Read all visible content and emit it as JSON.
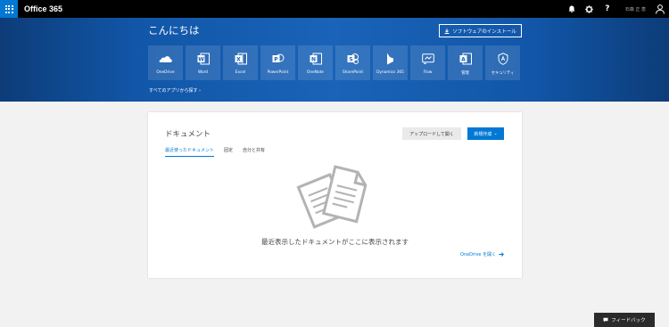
{
  "topbar": {
    "brand": "Office 365",
    "icons": [
      "waffle-icon",
      "bell-icon",
      "gear-icon",
      "help-icon",
      "user-avatar-icon"
    ],
    "help_glyph": "?",
    "user_name": "石森 正 恵"
  },
  "hero": {
    "greeting": "こんにちは",
    "install_label": "ソフトウェアのインストール",
    "all_apps_label": "すべてのアプリから探す",
    "tiles": [
      {
        "label": "OneDrive",
        "icon": "onedrive-icon"
      },
      {
        "label": "Word",
        "icon": "word-icon",
        "letter": "W"
      },
      {
        "label": "Excel",
        "icon": "excel-icon",
        "letter": "X"
      },
      {
        "label": "PowerPoint",
        "icon": "powerpoint-icon",
        "letter": "P"
      },
      {
        "label": "OneNote",
        "icon": "onenote-icon",
        "letter": "N"
      },
      {
        "label": "SharePoint",
        "icon": "sharepoint-icon",
        "letter": "S"
      },
      {
        "label": "Dynamics 365",
        "icon": "dynamics-icon"
      },
      {
        "label": "Flow",
        "icon": "flow-icon"
      },
      {
        "label": "管理",
        "icon": "admin-icon",
        "letter": "A"
      },
      {
        "label": "セキュリティ",
        "icon": "security-icon"
      }
    ]
  },
  "documents": {
    "title": "ドキュメント",
    "upload_label": "アップロードして開く",
    "new_label": "新規作成",
    "tabs": [
      "最近使ったドキュメント",
      "固定",
      "自分と共有"
    ],
    "active_tab": 0,
    "empty_message": "最近表示したドキュメントがここに表示されます",
    "open_onedrive_label": "OneDrive を開く"
  },
  "feedback": {
    "label": "フィードバック"
  },
  "colors": {
    "accent": "#0078d4",
    "hero": "#1156a8",
    "topbar": "#000000"
  }
}
